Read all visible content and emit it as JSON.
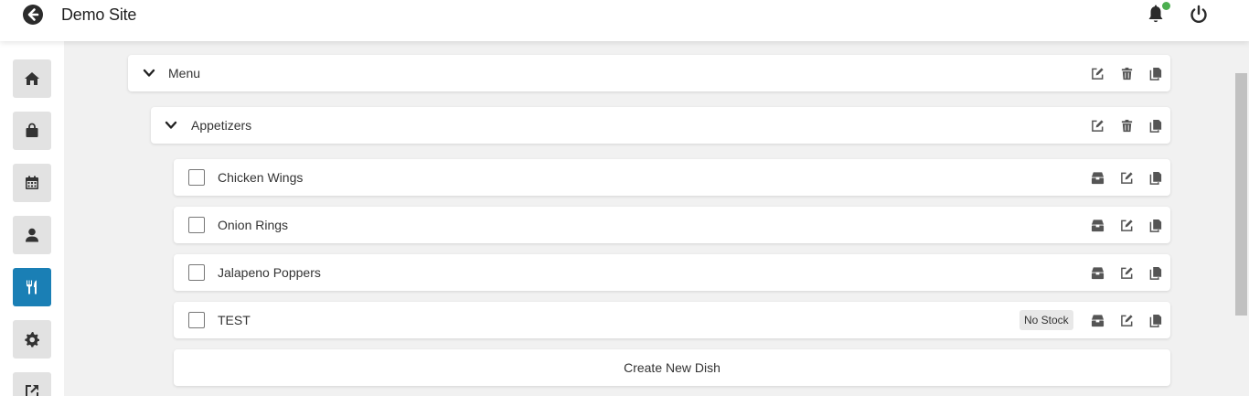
{
  "header": {
    "site_title": "Demo Site",
    "back_icon": "arrow-circle-left-icon",
    "notification_icon": "bell-icon",
    "power_icon": "power-icon",
    "notification_dot_color": "#4caf50"
  },
  "sidebar": {
    "active_color": "#1a7fb5",
    "items": [
      {
        "icon": "home-icon"
      },
      {
        "icon": "shopping-bag-icon"
      },
      {
        "icon": "calendar-icon"
      },
      {
        "icon": "user-icon"
      },
      {
        "icon": "utensils-icon",
        "active": true
      },
      {
        "icon": "gear-icon"
      },
      {
        "icon": "external-link-icon"
      }
    ]
  },
  "menu": {
    "category": {
      "label": "Menu"
    },
    "subcategory": {
      "label": "Appetizers"
    },
    "dishes": [
      {
        "label": "Chicken Wings",
        "badge": ""
      },
      {
        "label": "Onion Rings",
        "badge": ""
      },
      {
        "label": "Jalapeno Poppers",
        "badge": ""
      },
      {
        "label": "TEST",
        "badge": "No Stock"
      }
    ],
    "create_label": "Create New Dish"
  }
}
